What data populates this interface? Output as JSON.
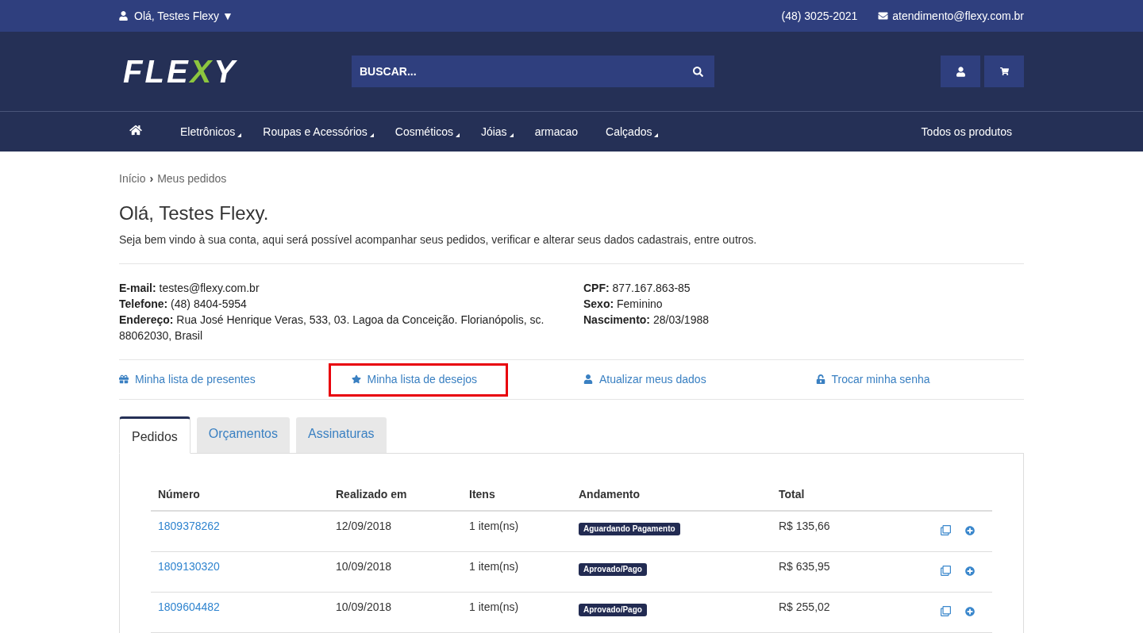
{
  "top_bar": {
    "user_menu": "Olá, Testes Flexy ▼",
    "phone": "(48) 3025-2021",
    "email": "atendimento@flexy.com.br"
  },
  "header": {
    "logo": "FLEXY",
    "search": {
      "placeholder": "BUSCAR..."
    }
  },
  "nav": {
    "items": [
      {
        "label": "Eletrônicos",
        "has_submenu": true
      },
      {
        "label": "Roupas e Acessórios",
        "has_submenu": true
      },
      {
        "label": "Cosméticos",
        "has_submenu": true
      },
      {
        "label": "Jóias",
        "has_submenu": true
      },
      {
        "label": "armacao",
        "has_submenu": false
      },
      {
        "label": "Calçados",
        "has_submenu": true
      }
    ],
    "all_products": "Todos os produtos"
  },
  "breadcrumb": {
    "items": [
      "Início",
      "Meus pedidos"
    ],
    "separator": "›"
  },
  "greeting": {
    "title": "Olá, Testes Flexy.",
    "text": "Seja bem vindo à sua conta, aqui será possível acompanhar seus pedidos, verificar e alterar seus dados cadastrais, entre outros."
  },
  "account_info": {
    "left": [
      "**E-mail:** testes@flexy.com.br",
      "**Telefone:** (48) 8404-5954",
      "**Endereço:** Rua José Henrique Veras, 533, 03. Lagoa da Conceição. Florianópolis, sc. 88062030, Brasil"
    ],
    "right": [
      "**CPF:** 877.167.863-85",
      "**Sexo:** Feminino",
      "**Nascimento:** 28/03/1988"
    ]
  },
  "account_links": [
    {
      "kind": "gift",
      "label": "Minha lista de presentes",
      "highlighted": false
    },
    {
      "kind": "star",
      "label": "Minha lista de desejos",
      "highlighted": true
    },
    {
      "kind": "user",
      "label": "Atualizar meus dados",
      "highlighted": false
    },
    {
      "kind": "unlock",
      "label": "Trocar minha senha",
      "highlighted": false
    }
  ],
  "tabs": [
    {
      "label": "Pedidos",
      "selected": true
    },
    {
      "label": "Orçamentos",
      "selected": false
    },
    {
      "label": "Assinaturas",
      "selected": false
    }
  ],
  "orders": {
    "columns": [
      "Número",
      "Realizado em",
      "Itens",
      "Andamento",
      "Total"
    ],
    "rows": [
      {
        "number": "1809378262",
        "date": "12/09/2018",
        "items": "1 item(ns)",
        "status": "Aguardando Pagamento",
        "total": "R$ 135,66"
      },
      {
        "number": "1809130320",
        "date": "10/09/2018",
        "items": "1 item(ns)",
        "status": "Aprovado/Pago",
        "total": "R$ 635,95"
      },
      {
        "number": "1809604482",
        "date": "10/09/2018",
        "items": "1 item(ns)",
        "status": "Aprovado/Pago",
        "total": "R$ 255,02"
      }
    ]
  }
}
